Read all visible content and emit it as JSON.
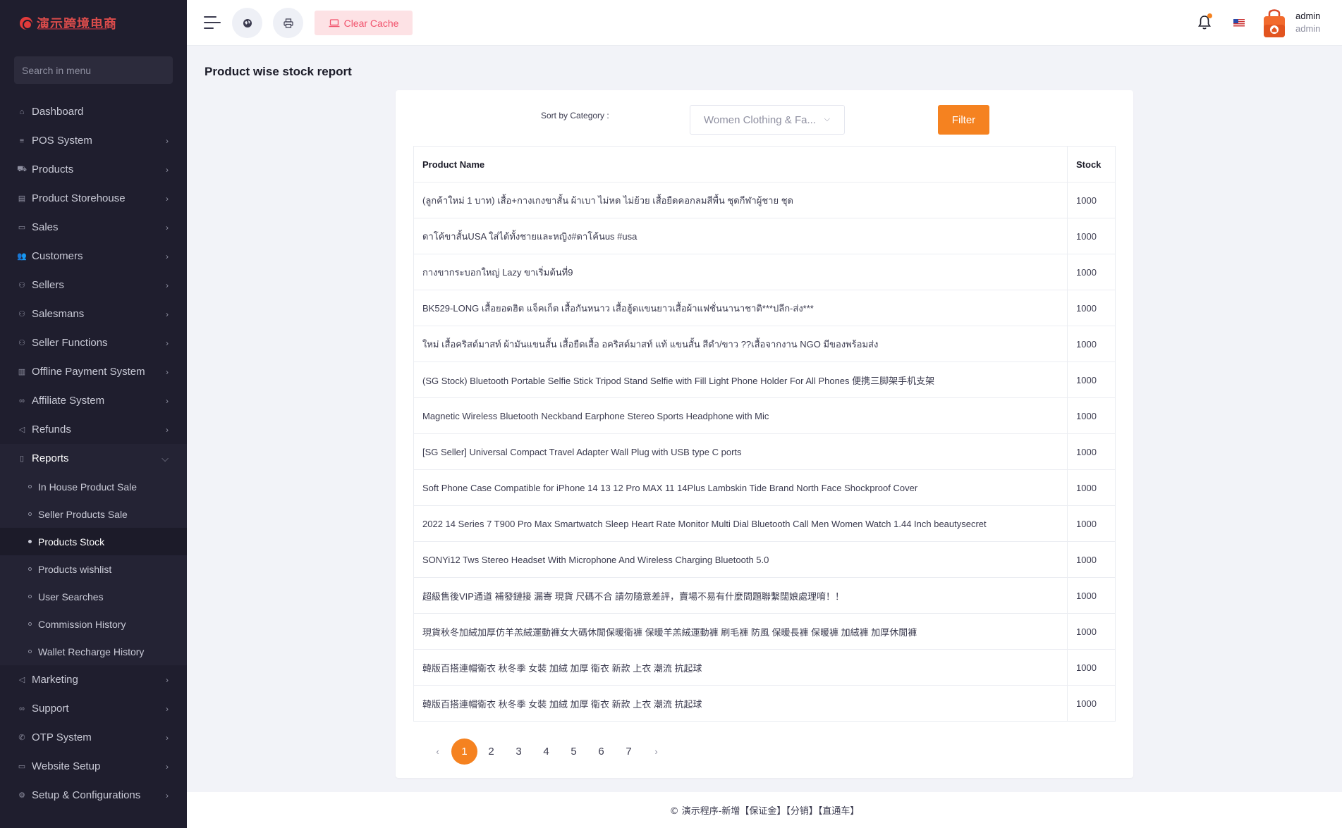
{
  "brand": {
    "logo_text": "演示跨境电商"
  },
  "sidebar": {
    "search_placeholder": "Search in menu",
    "items": [
      {
        "label": "Dashboard",
        "icon": "home-icon",
        "glyph": "⌂",
        "has_children": false
      },
      {
        "label": "POS System",
        "icon": "list-icon",
        "glyph": "≡",
        "has_children": true
      },
      {
        "label": "Products",
        "icon": "cart-icon",
        "glyph": "⛟",
        "has_children": true
      },
      {
        "label": "Product Storehouse",
        "icon": "storehouse-icon",
        "glyph": "▤",
        "has_children": true
      },
      {
        "label": "Sales",
        "icon": "money-icon",
        "glyph": "▭",
        "has_children": true
      },
      {
        "label": "Customers",
        "icon": "users-icon",
        "glyph": "👥",
        "has_children": true
      },
      {
        "label": "Sellers",
        "icon": "user-icon",
        "glyph": "⚇",
        "has_children": true
      },
      {
        "label": "Salesmans",
        "icon": "user-icon",
        "glyph": "⚇",
        "has_children": true
      },
      {
        "label": "Seller Functions",
        "icon": "user-icon",
        "glyph": "⚇",
        "has_children": true
      },
      {
        "label": "Offline Payment System",
        "icon": "payment-icon",
        "glyph": "▥",
        "has_children": true
      },
      {
        "label": "Affiliate System",
        "icon": "link-icon",
        "glyph": "∞",
        "has_children": true
      },
      {
        "label": "Refunds",
        "icon": "backward-icon",
        "glyph": "◁",
        "has_children": true
      }
    ],
    "reports": {
      "label": "Reports",
      "icon": "file-icon",
      "glyph": "▯",
      "children": [
        {
          "label": "In House Product Sale",
          "active": false
        },
        {
          "label": "Seller Products Sale",
          "active": false
        },
        {
          "label": "Products Stock",
          "active": true
        },
        {
          "label": "Products wishlist",
          "active": false
        },
        {
          "label": "User Searches",
          "active": false
        },
        {
          "label": "Commission History",
          "active": false
        },
        {
          "label": "Wallet Recharge History",
          "active": false
        }
      ]
    },
    "items_after": [
      {
        "label": "Marketing",
        "icon": "bullhorn-icon",
        "glyph": "◁",
        "has_children": true
      },
      {
        "label": "Support",
        "icon": "link-icon",
        "glyph": "∞",
        "has_children": true
      },
      {
        "label": "OTP System",
        "icon": "phone-icon",
        "glyph": "✆",
        "has_children": true
      },
      {
        "label": "Website Setup",
        "icon": "desktop-icon",
        "glyph": "▭",
        "has_children": true
      },
      {
        "label": "Setup & Configurations",
        "icon": "gear-icon",
        "glyph": "⚙",
        "has_children": true
      }
    ]
  },
  "topbar": {
    "clear_cache_label": "Clear Cache",
    "user_name": "admin",
    "user_role": "admin"
  },
  "page": {
    "title": "Product wise stock report",
    "sort_label": "Sort by Category :",
    "category_selected": "Women Clothing & Fa...",
    "filter_label": "Filter"
  },
  "table": {
    "headers": {
      "name": "Product Name",
      "stock": "Stock"
    },
    "rows": [
      {
        "name": "(ลูกค้าใหม่ 1 บาท) เสื้อ+กางเกงขาสั้น ผ้าเบา ไม่หด ไม่ย้วย เสื้อยืดคอกลมสีพื้น ชุดกีฬาผู้ชาย ชุด",
        "stock": "1000"
      },
      {
        "name": "ดาโค้ขาสั้นUSA ใส่ได้ทั้งชายและหญิง#ดาโค้นus #usa",
        "stock": "1000"
      },
      {
        "name": "กางขากระบอกใหญ่ Lazy ขาเริ่มต้นที่9",
        "stock": "1000"
      },
      {
        "name": "BK529-LONG เสื้อยอดฮิต แจ็คเก็ต เสื้อกันหนาว เสื้อฮู้ดแขนยาวเสื้อผ้าแฟชั่นนานาชาติ***ปลีก-ส่ง***",
        "stock": "1000"
      },
      {
        "name": "ใหม่ เสื้อคริสต์มาสท์ ผ้ามันแขนสั้น เสื้อยืดเสื้อ อคริสต์มาสท์ แท้ แขนสั้น สีดำ/ขาว ??เสื้อจากงาน NGO มีของพร้อมส่ง",
        "stock": "1000"
      },
      {
        "name": "(SG Stock) Bluetooth Portable Selfie Stick Tripod Stand Selfie with Fill Light Phone Holder For All Phones 便携三脚架手机支架",
        "stock": "1000"
      },
      {
        "name": "Magnetic Wireless Bluetooth Neckband Earphone Stereo Sports Headphone with Mic",
        "stock": "1000"
      },
      {
        "name": "[SG Seller] Universal Compact Travel Adapter Wall Plug with USB type C ports",
        "stock": "1000"
      },
      {
        "name": "Soft Phone Case Compatible for iPhone 14 13 12 Pro MAX 11 14Plus Lambskin Tide Brand North Face Shockproof Cover",
        "stock": "1000"
      },
      {
        "name": "2022 14 Series 7 T900 Pro Max Smartwatch Sleep Heart Rate Monitor Multi Dial Bluetooth Call Men Women Watch 1.44 Inch beautysecret",
        "stock": "1000"
      },
      {
        "name": "SONYi12 Tws Stereo Headset With Microphone And Wireless Charging Bluetooth 5.0",
        "stock": "1000"
      },
      {
        "name": "超級售後VIP通道 補發鏈接 漏寄 現貨 尺碼不合 請勿隨意差評，賣場不易有什麼問題聯繫闊娘處理唷！！",
        "stock": "1000"
      },
      {
        "name": "現貨秋冬加絨加厚仿羊羔絨運動褲女大碼休閒保暖衛褲 保暖羊羔絨運動褲 刷毛褲 防風 保暖長褲 保暖褲 加絨褲 加厚休閒褲",
        "stock": "1000"
      },
      {
        "name": "韓版百搭連帽衛衣 秋冬季 女裝 加絨 加厚 衛衣 新款 上衣 潮流 抗起球",
        "stock": "1000"
      },
      {
        "name": "韓版百搭連帽衛衣 秋冬季 女裝 加絨 加厚 衛衣 新款 上衣 潮流 抗起球",
        "stock": "1000"
      }
    ]
  },
  "pagination": {
    "prev": "‹",
    "next": "›",
    "pages": [
      "1",
      "2",
      "3",
      "4",
      "5",
      "6",
      "7"
    ],
    "current": "1"
  },
  "footer": {
    "text": "© 演示程序-新增【保证金】【分销】【直通车】"
  },
  "colors": {
    "accent": "#f58220",
    "sidebar_bg": "#1f1e2e",
    "clear_cache_bg": "#fde2e5",
    "clear_cache_text": "#f1516b"
  }
}
